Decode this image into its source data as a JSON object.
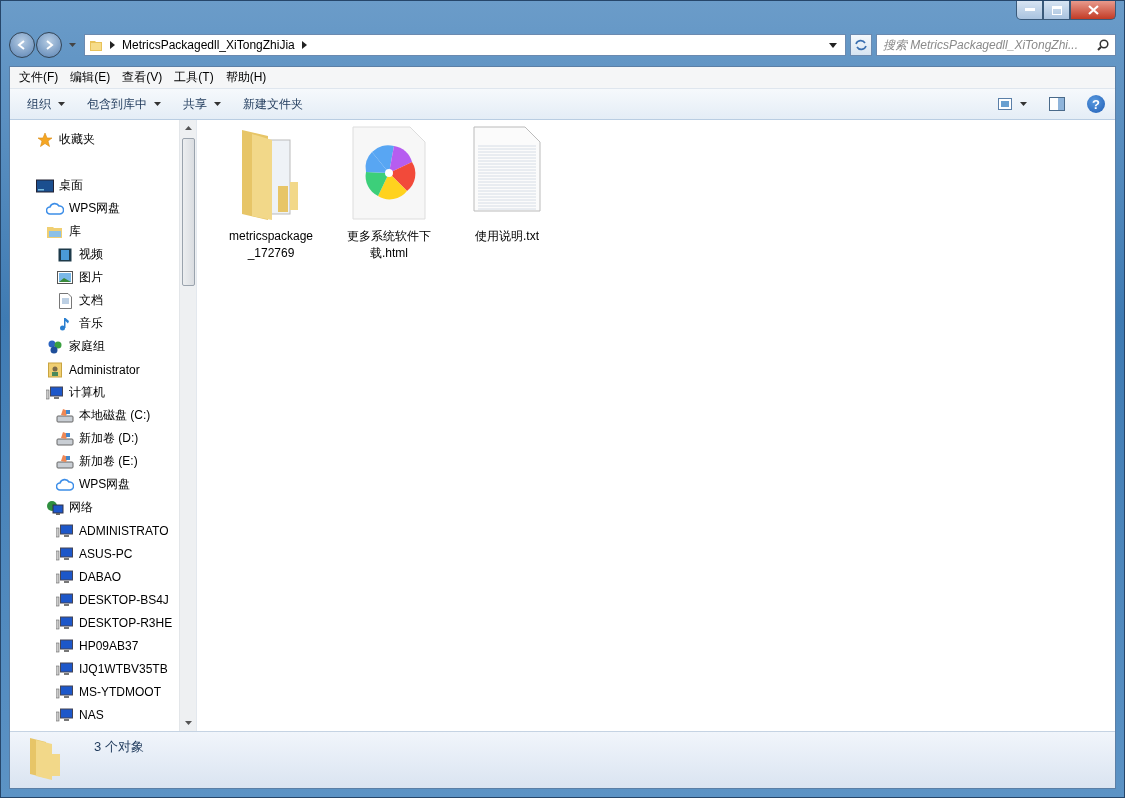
{
  "address": {
    "crumbs": [
      "MetricsPackagedll_XiTongZhiJia"
    ]
  },
  "search": {
    "placeholder": "搜索 MetricsPackagedll_XiTongZhi..."
  },
  "menu": [
    "文件(F)",
    "编辑(E)",
    "查看(V)",
    "工具(T)",
    "帮助(H)"
  ],
  "toolbar": [
    {
      "label": "组织",
      "dropdown": true
    },
    {
      "label": "包含到库中",
      "dropdown": true
    },
    {
      "label": "共享",
      "dropdown": true
    },
    {
      "label": "新建文件夹",
      "dropdown": false
    }
  ],
  "help_button": "?",
  "sidebar": {
    "items": [
      {
        "label": "收藏夹",
        "kind": "star"
      },
      {
        "label": "桌面",
        "kind": "desktop",
        "children": [
          {
            "label": "WPS网盘",
            "kind": "cloud"
          },
          {
            "label": "库",
            "kind": "library",
            "children": [
              {
                "label": "视频",
                "kind": "video"
              },
              {
                "label": "图片",
                "kind": "picture"
              },
              {
                "label": "文档",
                "kind": "document"
              },
              {
                "label": "音乐",
                "kind": "music"
              }
            ]
          },
          {
            "label": "家庭组",
            "kind": "homegroup"
          },
          {
            "label": "Administrator",
            "kind": "user"
          },
          {
            "label": "计算机",
            "kind": "computer",
            "children": [
              {
                "label": "本地磁盘 (C:)",
                "kind": "drive"
              },
              {
                "label": "新加卷 (D:)",
                "kind": "drive"
              },
              {
                "label": "新加卷 (E:)",
                "kind": "drive"
              },
              {
                "label": "WPS网盘",
                "kind": "cloud"
              }
            ]
          },
          {
            "label": "网络",
            "kind": "network",
            "children": [
              {
                "label": "ADMINISTRATO",
                "kind": "pc"
              },
              {
                "label": "ASUS-PC",
                "kind": "pc"
              },
              {
                "label": "DABAO",
                "kind": "pc"
              },
              {
                "label": "DESKTOP-BS4J",
                "kind": "pc"
              },
              {
                "label": "DESKTOP-R3HE",
                "kind": "pc"
              },
              {
                "label": "HP09AB37",
                "kind": "pc"
              },
              {
                "label": "IJQ1WTBV35TB",
                "kind": "pc"
              },
              {
                "label": "MS-YTDMOOT",
                "kind": "pc"
              },
              {
                "label": "NAS",
                "kind": "pc"
              }
            ]
          }
        ]
      }
    ]
  },
  "files": [
    {
      "name": "metricspackage_172769",
      "kind": "folder"
    },
    {
      "name": "更多系统软件下载.html",
      "kind": "html"
    },
    {
      "name": "使用说明.txt",
      "kind": "txt"
    }
  ],
  "status_bar": {
    "count": "3 个对象"
  }
}
